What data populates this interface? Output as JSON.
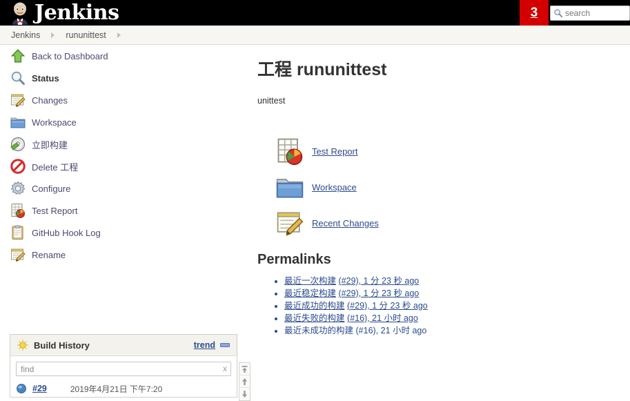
{
  "header": {
    "brand": "Jenkins",
    "logo_icon": "jenkins-butler-logo",
    "build_queue_count": "3",
    "search": {
      "placeholder": "search",
      "value": "",
      "icon": "search-icon"
    }
  },
  "breadcrumbs": [
    {
      "label": "Jenkins"
    },
    {
      "label": "rununittest"
    }
  ],
  "sidebar": {
    "tasks": [
      {
        "label": "Back to Dashboard",
        "icon": "up-arrow-icon",
        "bold": false
      },
      {
        "label": "Status",
        "icon": "magnifier-icon",
        "bold": true
      },
      {
        "label": "Changes",
        "icon": "notepad-pencil-icon",
        "bold": false
      },
      {
        "label": "Workspace",
        "icon": "folder-icon",
        "bold": false
      },
      {
        "label": "立即构建",
        "icon": "build-now-icon",
        "bold": false
      },
      {
        "label": "Delete 工程",
        "icon": "delete-forbidden-icon",
        "bold": false
      },
      {
        "label": "Configure",
        "icon": "gear-icon",
        "bold": false
      },
      {
        "label": "Test Report",
        "icon": "test-report-icon",
        "bold": false
      },
      {
        "label": "GitHub Hook Log",
        "icon": "clipboard-icon",
        "bold": false
      },
      {
        "label": "Rename",
        "icon": "notepad-pencil-icon",
        "bold": false
      }
    ],
    "build_history": {
      "title": "Build History",
      "title_icon": "sun-weather-icon",
      "trend_label": "trend",
      "trend_icon": "trend-bar-icon",
      "find_placeholder": "find",
      "find_value": "",
      "find_clear_label": "x",
      "builds": [
        {
          "number": "#29",
          "date": "2019年4月21日 下午7:20",
          "status_icon": "blue-ball-icon"
        }
      ],
      "scroll_buttons": [
        {
          "icon": "scroll-top-icon"
        },
        {
          "icon": "scroll-up-icon"
        },
        {
          "icon": "scroll-down-icon"
        }
      ]
    }
  },
  "main": {
    "title": "工程 rununittest",
    "description": "unittest",
    "actions": [
      {
        "label": "Test Report",
        "icon": "test-report-icon"
      },
      {
        "label": "Workspace",
        "icon": "folder-icon"
      },
      {
        "label": "Recent Changes",
        "icon": "notepad-pencil-icon"
      }
    ],
    "permalinks_title": "Permalinks",
    "permalinks": [
      {
        "label": "最近一次构建",
        "meta": "(#29), 1 分 23 秒 ago",
        "underlined": true
      },
      {
        "label": "最近稳定构建",
        "meta": "(#29), 1 分 23 秒 ago",
        "underlined": true
      },
      {
        "label": "最近成功的构建",
        "meta": "(#29), 1 分 23 秒 ago",
        "underlined": true
      },
      {
        "label": "最近失败的构建",
        "meta": "(#16), 21 小时 ago",
        "underlined": true
      },
      {
        "label": "最近未成功的构建",
        "meta": "(#16), 21 小时 ago",
        "underlined": false
      }
    ]
  },
  "colors": {
    "header_bg": "#000000",
    "badge_bg": "#d40000",
    "breadcrumb_bg": "#f7f6f1",
    "link": "#2b4b8f",
    "task_link": "#4a4a70"
  }
}
